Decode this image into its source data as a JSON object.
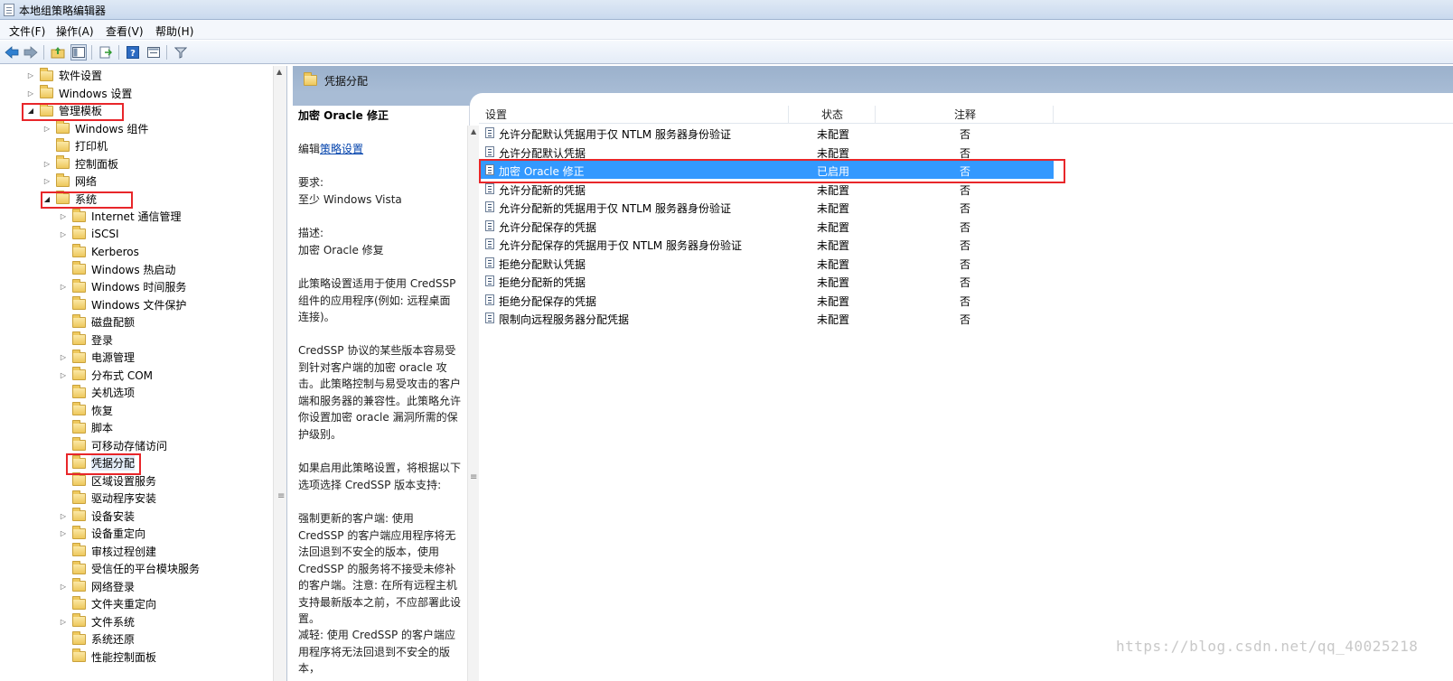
{
  "window": {
    "title": "本地组策略编辑器"
  },
  "menu": {
    "file": "文件(F)",
    "action": "操作(A)",
    "view": "查看(V)",
    "help": "帮助(H)"
  },
  "tree": {
    "items": [
      {
        "label": "软件设置",
        "arrow": "▷"
      },
      {
        "label": "Windows 设置",
        "arrow": "▷"
      },
      {
        "label": "管理模板",
        "arrow": "◢"
      },
      {
        "label": "Windows 组件",
        "arrow": "▷"
      },
      {
        "label": "打印机",
        "arrow": ""
      },
      {
        "label": "控制面板",
        "arrow": "▷"
      },
      {
        "label": "网络",
        "arrow": "▷"
      },
      {
        "label": "系统",
        "arrow": "◢"
      },
      {
        "label": "Internet 通信管理",
        "arrow": "▷"
      },
      {
        "label": "iSCSI",
        "arrow": "▷"
      },
      {
        "label": "Kerberos",
        "arrow": ""
      },
      {
        "label": "Windows 热启动",
        "arrow": ""
      },
      {
        "label": "Windows 时间服务",
        "arrow": "▷"
      },
      {
        "label": "Windows 文件保护",
        "arrow": ""
      },
      {
        "label": "磁盘配额",
        "arrow": ""
      },
      {
        "label": "登录",
        "arrow": ""
      },
      {
        "label": "电源管理",
        "arrow": "▷"
      },
      {
        "label": "分布式 COM",
        "arrow": "▷"
      },
      {
        "label": "关机选项",
        "arrow": ""
      },
      {
        "label": "恢复",
        "arrow": ""
      },
      {
        "label": "脚本",
        "arrow": ""
      },
      {
        "label": "可移动存储访问",
        "arrow": ""
      },
      {
        "label": "凭据分配",
        "arrow": ""
      },
      {
        "label": "区域设置服务",
        "arrow": ""
      },
      {
        "label": "驱动程序安装",
        "arrow": ""
      },
      {
        "label": "设备安装",
        "arrow": "▷"
      },
      {
        "label": "设备重定向",
        "arrow": "▷"
      },
      {
        "label": "审核过程创建",
        "arrow": ""
      },
      {
        "label": "受信任的平台模块服务",
        "arrow": ""
      },
      {
        "label": "网络登录",
        "arrow": "▷"
      },
      {
        "label": "文件夹重定向",
        "arrow": ""
      },
      {
        "label": "文件系统",
        "arrow": "▷"
      },
      {
        "label": "系统还原",
        "arrow": ""
      },
      {
        "label": "性能控制面板",
        "arrow": ""
      }
    ]
  },
  "content": {
    "header_title": "凭据分配",
    "description": {
      "title": "加密 Oracle 修正",
      "edit_prefix": "编辑",
      "edit_link": "策略设置",
      "requirement_label": "要求:",
      "requirement_value": "至少 Windows Vista",
      "desc_label": "描述:",
      "desc_value": "加密 Oracle 修复",
      "para1": "此策略设置适用于使用 CredSSP 组件的应用程序(例如: 远程桌面连接)。",
      "para2": "CredSSP 协议的某些版本容易受到针对客户端的加密 oracle 攻击。此策略控制与易受攻击的客户端和服务器的兼容性。此策略允许你设置加密 oracle 漏洞所需的保护级别。",
      "para3": "如果启用此策略设置，将根据以下选项选择 CredSSP 版本支持:",
      "para4": "强制更新的客户端: 使用 CredSSP 的客户端应用程序将无法回退到不安全的版本，使用 CredSSP 的服务将不接受未修补的客户端。注意: 在所有远程主机支持最新版本之前，不应部署此设置。",
      "para5": "减轻: 使用 CredSSP 的客户端应用程序将无法回退到不安全的版本，"
    },
    "columns": {
      "setting": "设置",
      "state": "状态",
      "note": "注释"
    },
    "rows": [
      {
        "name": "允许分配默认凭据用于仅 NTLM 服务器身份验证",
        "state": "未配置",
        "note": "否"
      },
      {
        "name": "允许分配默认凭据",
        "state": "未配置",
        "note": "否"
      },
      {
        "name": "加密 Oracle 修正",
        "state": "已启用",
        "note": "否"
      },
      {
        "name": "允许分配新的凭据",
        "state": "未配置",
        "note": "否"
      },
      {
        "name": "允许分配新的凭据用于仅 NTLM 服务器身份验证",
        "state": "未配置",
        "note": "否"
      },
      {
        "name": "允许分配保存的凭据",
        "state": "未配置",
        "note": "否"
      },
      {
        "name": "允许分配保存的凭据用于仅 NTLM 服务器身份验证",
        "state": "未配置",
        "note": "否"
      },
      {
        "name": "拒绝分配默认凭据",
        "state": "未配置",
        "note": "否"
      },
      {
        "name": "拒绝分配新的凭据",
        "state": "未配置",
        "note": "否"
      },
      {
        "name": "拒绝分配保存的凭据",
        "state": "未配置",
        "note": "否"
      },
      {
        "name": "限制向远程服务器分配凭据",
        "state": "未配置",
        "note": "否"
      }
    ]
  },
  "watermark": "https://blog.csdn.net/qq_40025218",
  "colors": {
    "selection": "#3399ff",
    "highlight_box": "#e8262a",
    "header_band": "#a8bcd5"
  },
  "icons": [
    "back-arrow-icon",
    "forward-arrow-icon",
    "up-folder-icon",
    "show-hide-tree-icon",
    "export-list-icon",
    "help-icon",
    "properties-icon",
    "filter-icon",
    "folder-icon",
    "policy-setting-icon"
  ]
}
